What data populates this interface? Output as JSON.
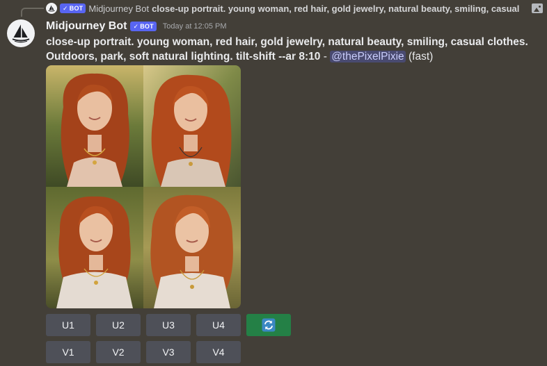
{
  "reply": {
    "author": "Midjourney Bot",
    "bot_tag": "BOT",
    "text": "close-up portrait. young woman, red hair, gold jewelry, natural beauty, smiling, casual",
    "image_icon": "image-icon"
  },
  "message": {
    "author": "Midjourney Bot",
    "bot_tag": "BOT",
    "timestamp": "Today at 12:05 PM",
    "prompt": "close-up portrait. young woman, red hair, gold jewelry, natural beauty, smiling, casual clothes. Outdoors, park, soft natural lighting. tilt-shift --ar 8:10",
    "separator": " - ",
    "mention": "@thePixelPixie",
    "mode": "(fast)"
  },
  "upscale_buttons": [
    "U1",
    "U2",
    "U3",
    "U4"
  ],
  "reroll_icon": "refresh-icon",
  "variation_buttons": [
    "V1",
    "V2",
    "V3",
    "V4"
  ],
  "colors": {
    "background": "#433f38",
    "bot_tag": "#5865f2",
    "button": "#4e5058",
    "reroll_button": "#248046",
    "mention_bg": "rgba(88,101,242,0.3)"
  }
}
